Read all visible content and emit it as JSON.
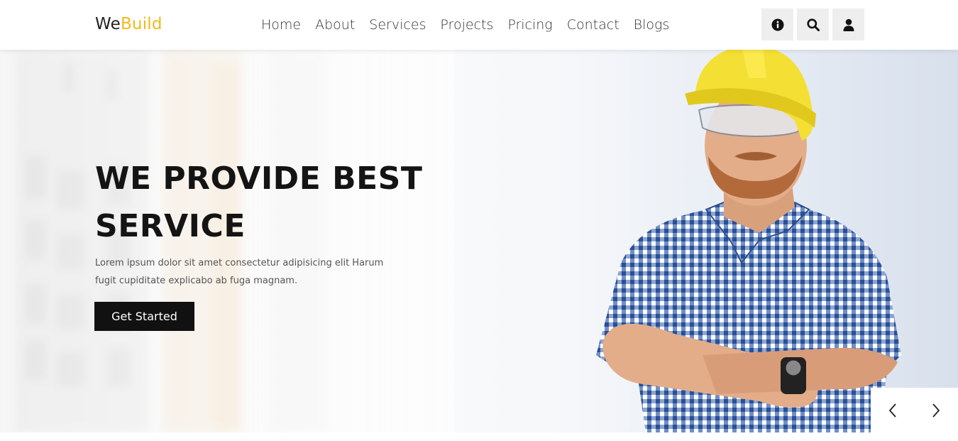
{
  "header": {
    "logo_prefix": "We",
    "logo_accent": "Build",
    "accent_color": "#f2b91a",
    "nav": [
      "Home",
      "About",
      "Services",
      "Projects",
      "Pricing",
      "Contact",
      "Blogs"
    ],
    "icons": [
      "info-icon",
      "search-icon",
      "user-icon"
    ]
  },
  "hero": {
    "title": "WE PROVIDE BEST SERVICE",
    "text": "Lorem ipsum dolor sit amet consectetur adipisicing elit Harum fugit cupiditate explicabo ab fuga magnam.",
    "cta_label": "Get Started"
  },
  "slider": {
    "prev_icon": "chevron-left-icon",
    "next_icon": "chevron-right-icon"
  }
}
